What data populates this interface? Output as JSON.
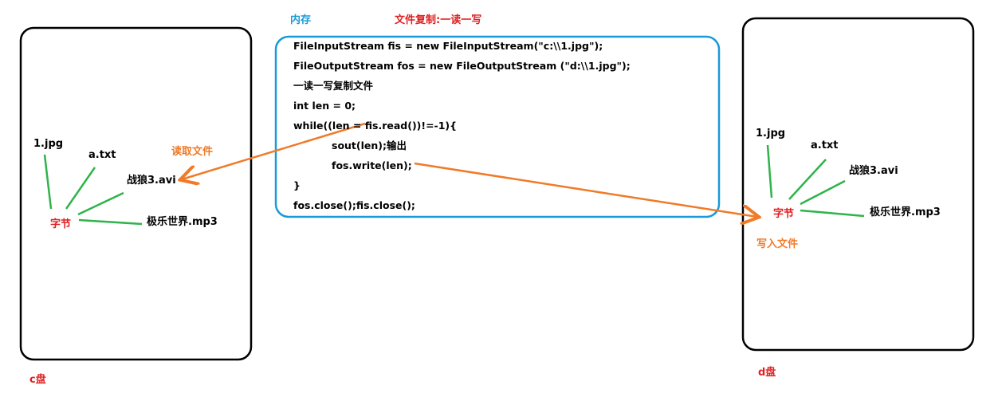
{
  "headers": {
    "memory": "内存",
    "title": "文件复制:一读一写"
  },
  "code_lines": [
    "FileInputStream fis = new FileInputStream(\"c:\\\\1.jpg\");",
    "FileOutputStream fos = new FileOutputStream (\"d:\\\\1.jpg\");",
    "一读一写复制文件",
    "int len = 0;",
    "while((len  = fis.read())!=-1){",
    "sout(len);输出",
    "fos.write(len);",
    "}",
    "fos.close();fis.close();"
  ],
  "c_drive": {
    "label": "c盘",
    "center": "字节",
    "files": [
      "1.jpg",
      "a.txt",
      "战狼3.avi",
      "极乐世界.mp3"
    ]
  },
  "d_drive": {
    "label": "d盘",
    "center": "字节",
    "files": [
      "1.jpg",
      "a.txt",
      "战狼3.avi",
      "极乐世界.mp3"
    ]
  },
  "arrows": {
    "read": "读取文件",
    "write": "写入文件"
  },
  "colors": {
    "memory_box": "#1a9ad8",
    "arrow": "#f07a28",
    "connector": "#2fb34a",
    "accent_red": "#e02020"
  }
}
